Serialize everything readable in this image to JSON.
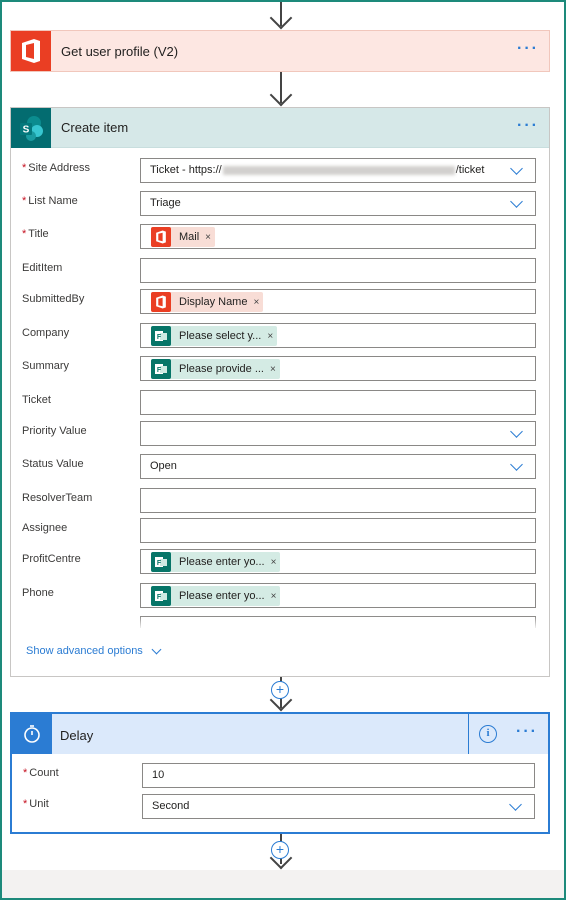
{
  "profile_card": {
    "title": "Get user profile (V2)",
    "menu_label": "···",
    "icon": "office-365-icon",
    "accent_color": "#ea3e23"
  },
  "create_item_card": {
    "title": "Create item",
    "menu_label": "···",
    "icon": "sharepoint-icon",
    "accent_color": "#036c70",
    "fields": [
      {
        "label": "Site Address",
        "required": true,
        "type": "dropdown",
        "value_prefix": "Ticket - https://",
        "value_suffix": "/ticket"
      },
      {
        "label": "List Name",
        "required": true,
        "type": "dropdown",
        "value": "Triage"
      },
      {
        "label": "Title",
        "required": true,
        "type": "token",
        "token_source": "office",
        "token_text": "Mail"
      },
      {
        "label": "EditItem",
        "required": false,
        "type": "text",
        "value": ""
      },
      {
        "label": "SubmittedBy",
        "required": false,
        "type": "token",
        "token_source": "office",
        "token_text": "Display Name"
      },
      {
        "label": "Company",
        "required": false,
        "type": "token",
        "token_source": "forms",
        "token_text": "Please select y..."
      },
      {
        "label": "Summary",
        "required": false,
        "type": "token",
        "token_source": "forms",
        "token_text": "Please provide ..."
      },
      {
        "label": "Ticket",
        "required": false,
        "type": "text",
        "value": ""
      },
      {
        "label": "Priority Value",
        "required": false,
        "type": "dropdown",
        "value": ""
      },
      {
        "label": "Status Value",
        "required": false,
        "type": "dropdown",
        "value": "Open"
      },
      {
        "label": "ResolverTeam",
        "required": false,
        "type": "text",
        "value": ""
      },
      {
        "label": "Assignee",
        "required": false,
        "type": "text",
        "value": ""
      },
      {
        "label": "ProfitCentre",
        "required": false,
        "type": "token",
        "token_source": "forms",
        "token_text": "Please enter yo..."
      },
      {
        "label": "Phone",
        "required": false,
        "type": "token",
        "token_source": "forms",
        "token_text": "Please enter yo..."
      }
    ],
    "advanced_link": "Show advanced options"
  },
  "delay_card": {
    "title": "Delay",
    "menu_label": "···",
    "info_label": "i",
    "icon": "timer-icon",
    "accent_color": "#2b7cd3",
    "count_label": "Count",
    "count_value": "10",
    "unit_label": "Unit",
    "unit_value": "Second"
  },
  "remove_token_label": "×",
  "required_marker": "*",
  "insert_step_label": "+"
}
